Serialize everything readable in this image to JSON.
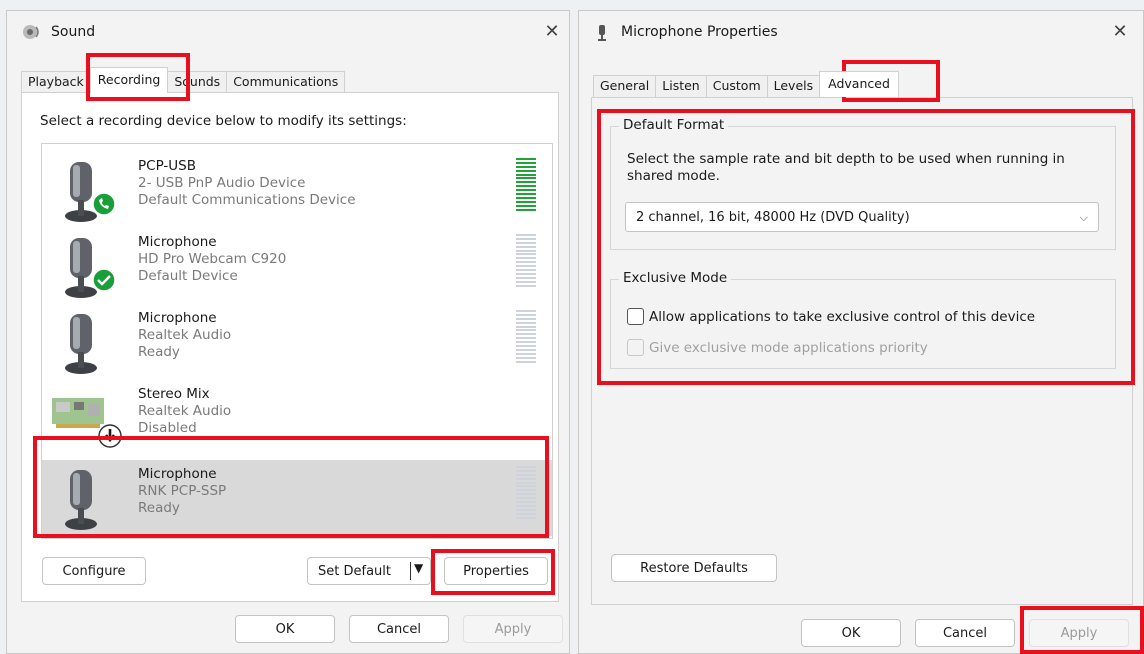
{
  "sound": {
    "title": "Sound",
    "tabs": [
      "Playback",
      "Recording",
      "Sounds",
      "Communications"
    ],
    "instruction": "Select a recording device below to modify its settings:",
    "devices": [
      {
        "name": "PCP-USB",
        "line1": "2- USB PnP Audio Device",
        "line2": "Default Communications Device",
        "icon": "microphone-icon",
        "badge": "phone-badge-icon",
        "meter": "active-green"
      },
      {
        "name": "Microphone",
        "line1": "HD Pro Webcam C920",
        "line2": "Default Device",
        "icon": "microphone-icon",
        "badge": "check-badge-icon",
        "meter": "idle"
      },
      {
        "name": "Microphone",
        "line1": "Realtek Audio",
        "line2": "Ready",
        "icon": "microphone-icon",
        "meter": "idle"
      },
      {
        "name": "Stereo Mix",
        "line1": "Realtek Audio",
        "line2": "Disabled",
        "icon": "sound-card-icon",
        "badge": "disabled-arrow-icon",
        "meter": "none"
      },
      {
        "name": "Microphone",
        "line1": "RNK PCP-SSP",
        "line2": "Ready",
        "icon": "microphone-icon",
        "meter": "idle",
        "selected": true
      }
    ],
    "configure_label": "Configure",
    "set_default_label": "Set Default",
    "properties_label": "Properties",
    "ok_label": "OK",
    "cancel_label": "Cancel",
    "apply_label": "Apply"
  },
  "props": {
    "title": "Microphone Properties",
    "tabs": [
      "General",
      "Listen",
      "Custom",
      "Levels",
      "Advanced"
    ],
    "default_format": {
      "title": "Default Format",
      "description": "Select the sample rate and bit depth to be used when running in shared mode.",
      "selected_format": "2 channel, 16 bit, 48000 Hz (DVD Quality)"
    },
    "exclusive_mode": {
      "title": "Exclusive Mode",
      "allow_label": "Allow applications to take exclusive control of this device",
      "priority_label": "Give exclusive mode applications priority"
    },
    "restore_label": "Restore Defaults",
    "ok_label": "OK",
    "cancel_label": "Cancel",
    "apply_label": "Apply"
  },
  "colors": {
    "highlight": "#e8101f",
    "meter_active": "#22a33a",
    "badge_green": "#1a9e3a"
  }
}
